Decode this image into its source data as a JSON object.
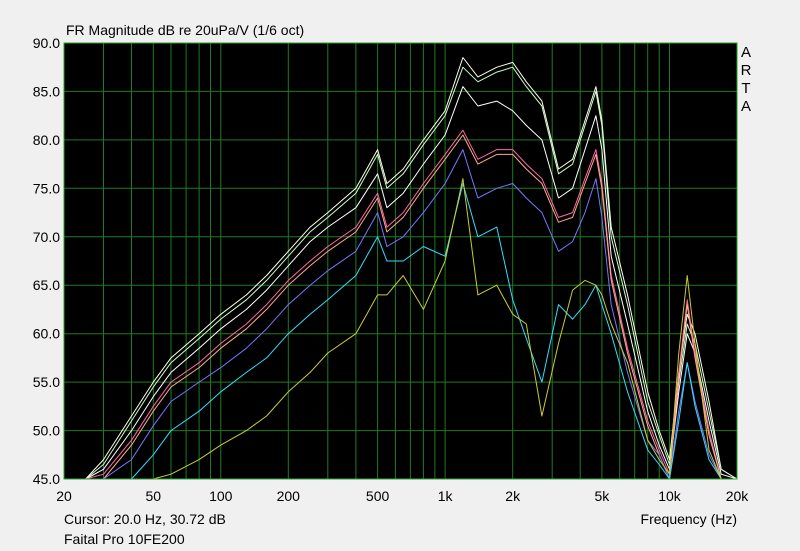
{
  "title": "FR Magnitude dB re 20uPa/V (1/6 oct)",
  "cursor_readout": "Cursor: 20.0 Hz, 30.72 dB",
  "device": "Faital Pro 10FE200",
  "brand_letters": [
    "A",
    "R",
    "T",
    "A"
  ],
  "colors": {
    "background": "#000000",
    "grid": "#1f7a1f",
    "frame": "#2aa02a"
  },
  "chart_data": {
    "type": "line",
    "title": "FR Magnitude dB re 20uPa/V (1/6 oct)",
    "xlabel": "Frequency (Hz)",
    "ylabel": "",
    "xscale": "log",
    "xlim": [
      20,
      20000
    ],
    "ylim": [
      45,
      90
    ],
    "x_ticks": [
      20,
      50,
      100,
      200,
      500,
      1000,
      2000,
      5000,
      10000,
      20000
    ],
    "x_tick_labels": [
      "20",
      "50",
      "100",
      "200",
      "500",
      "1k",
      "2k",
      "5k",
      "10k",
      "20k"
    ],
    "y_ticks": [
      45,
      50,
      55,
      60,
      65,
      70,
      75,
      80,
      85,
      90
    ],
    "y_tick_labels": [
      "45.0",
      "50.0",
      "55.0",
      "60.0",
      "65.0",
      "70.0",
      "75.0",
      "80.0",
      "85.0",
      "90.0"
    ],
    "grid": true,
    "x": [
      20,
      25,
      30,
      40,
      50,
      60,
      80,
      100,
      130,
      160,
      200,
      250,
      300,
      400,
      500,
      550,
      650,
      800,
      1000,
      1200,
      1400,
      1700,
      2000,
      2300,
      2700,
      3200,
      3700,
      4200,
      4700,
      5000,
      5500,
      6500,
      8000,
      9000,
      10000,
      11000,
      12000,
      13000,
      15000,
      17000,
      20000
    ],
    "series": [
      {
        "color": "#ffffe8",
        "values": [
          45,
          45,
          47,
          51.5,
          55,
          57.5,
          60,
          62,
          64,
          66,
          68.5,
          71,
          72.5,
          75,
          79,
          75.5,
          77,
          80,
          83,
          88.5,
          86.5,
          87.5,
          88,
          86,
          84,
          77,
          78,
          82,
          85.5,
          82,
          71,
          64,
          54,
          50,
          47,
          56,
          62,
          60,
          53,
          46,
          45
        ]
      },
      {
        "color": "#ccffcc",
        "values": [
          45,
          45,
          46.5,
          51,
          54.5,
          57,
          59.5,
          61.5,
          63.5,
          65.5,
          68,
          70.5,
          72,
          74.5,
          78.5,
          75,
          76.5,
          79.5,
          82.5,
          87.5,
          86,
          87,
          87.5,
          85.5,
          83.5,
          76.5,
          77.5,
          81.5,
          85,
          81.5,
          70,
          63,
          53,
          49.5,
          46.5,
          55,
          61,
          59,
          52,
          46,
          45
        ]
      },
      {
        "color": "#ffffff",
        "values": [
          45,
          45,
          46,
          50,
          53.5,
          56,
          58.5,
          60.5,
          62.5,
          64.5,
          67,
          69.5,
          71,
          73,
          76.5,
          73,
          74.5,
          77.5,
          80.5,
          85.5,
          83.5,
          84,
          83,
          81.5,
          80,
          74,
          75,
          79,
          82.5,
          79,
          68,
          61,
          52,
          48.5,
          46,
          54,
          60,
          58,
          51,
          45.5,
          45
        ]
      },
      {
        "color": "#ff66aa",
        "values": [
          45,
          45,
          45.5,
          49,
          52.5,
          55,
          57,
          59,
          61,
          63,
          65.5,
          67.5,
          69,
          71,
          74.5,
          71,
          72.5,
          75.5,
          78.5,
          81,
          78,
          79,
          79,
          77.5,
          76,
          72,
          72.5,
          76,
          79,
          75.5,
          66,
          58.5,
          51,
          48,
          45.5,
          56,
          63.5,
          58,
          50,
          45,
          45
        ]
      },
      {
        "color": "#ffaa88",
        "values": [
          45,
          45,
          45,
          48.5,
          52,
          54.5,
          56.5,
          58.5,
          60.5,
          62.5,
          65,
          67,
          68.5,
          70.5,
          74,
          70.5,
          72,
          75,
          78,
          80.5,
          77.5,
          78.5,
          78.5,
          77,
          75.5,
          71.5,
          72,
          75.5,
          78.5,
          75,
          65.5,
          58,
          50.5,
          47.5,
          45,
          55.5,
          63,
          57.5,
          49.5,
          45,
          45
        ]
      },
      {
        "color": "#7777ff",
        "values": [
          45,
          45,
          45,
          47,
          50.5,
          53,
          55,
          56.5,
          58.5,
          60.5,
          63,
          65,
          66.5,
          68.5,
          72.5,
          69,
          70,
          72.5,
          75.5,
          79,
          74,
          75,
          75.5,
          74,
          72.5,
          68.5,
          69.5,
          72.5,
          76,
          72,
          63,
          56,
          49,
          47.5,
          45,
          52,
          57,
          53,
          47.5,
          45,
          45
        ]
      },
      {
        "color": "#33ddff",
        "values": [
          45,
          45,
          45,
          45,
          47.5,
          50,
          52,
          54,
          56,
          57.5,
          60,
          62,
          63.5,
          66,
          70,
          67.5,
          67.5,
          69,
          68,
          75.5,
          70,
          71,
          63.5,
          59.5,
          55,
          63,
          61.5,
          63,
          65,
          63,
          60,
          54,
          48,
          46.5,
          45,
          51,
          57,
          52.5,
          47,
          45,
          45
        ]
      },
      {
        "color": "#cccc33",
        "values": [
          45,
          45,
          45,
          45,
          45,
          45.5,
          47,
          48.5,
          50,
          51.5,
          54,
          56,
          58,
          60,
          64,
          64,
          66,
          62.5,
          67.5,
          76,
          64,
          65,
          62,
          61,
          51.5,
          59,
          64.5,
          65.5,
          65,
          64,
          61,
          57,
          49,
          47,
          45.5,
          58,
          66,
          59,
          48,
          45,
          45
        ]
      }
    ]
  }
}
